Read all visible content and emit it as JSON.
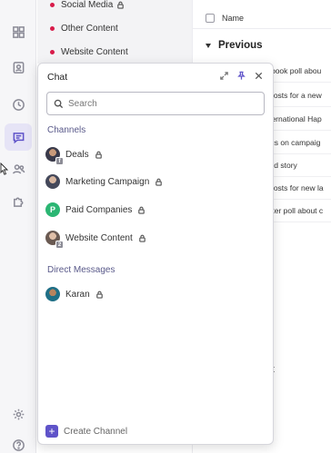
{
  "nav": {
    "items": [
      {
        "label": "Social Media",
        "locked": true
      },
      {
        "label": "Other Content",
        "locked": false
      },
      {
        "label": "Website Content",
        "locked": false
      }
    ]
  },
  "content": {
    "column_header": "Name",
    "section_title": "Previous",
    "rows": [
      "cebook poll abou",
      "e posts for a new",
      "International Hap",
      "ytics on campaig",
      "rand story",
      "e posts for new la",
      "witter poll about c"
    ],
    "partial_letter": "t"
  },
  "chat": {
    "title": "Chat",
    "search_placeholder": "Search",
    "channels_title": "Channels",
    "channels": [
      {
        "name": "Deals",
        "badge": "f"
      },
      {
        "name": "Marketing Campaign",
        "badge": ""
      },
      {
        "name": "Paid Companies",
        "avatar_letter": "P"
      },
      {
        "name": "Website Content",
        "badge": "2"
      }
    ],
    "dm_title": "Direct Messages",
    "direct_messages": [
      {
        "name": "Karan"
      }
    ],
    "create_channel": "Create Channel"
  },
  "colors": {
    "accent": "#5f53c9",
    "dot": "#d81b4a",
    "paid_avatar": "#2bb673"
  }
}
